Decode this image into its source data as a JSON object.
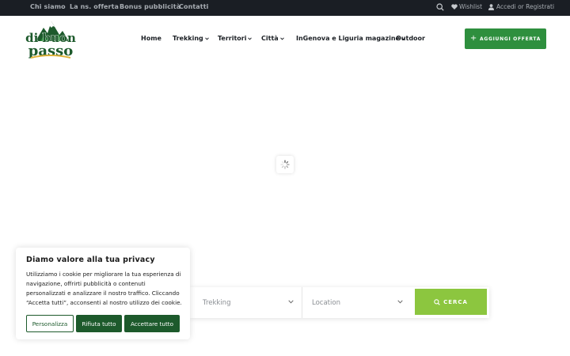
{
  "topbar": {
    "links": [
      "Chi siamo",
      "La ns. offerta",
      "Bonus pubblicità",
      "Contatti"
    ],
    "search_icon": "search-icon",
    "wishlist_label": "Wishlist",
    "account_label": "Accedi or Registrati"
  },
  "logo": {
    "line1": "di buon",
    "line2": "passo"
  },
  "nav": {
    "items": [
      {
        "label": "Home",
        "dropdown": false
      },
      {
        "label": "Trekking",
        "dropdown": true
      },
      {
        "label": "Territori",
        "dropdown": true
      },
      {
        "label": "Città",
        "dropdown": true
      },
      {
        "label": "InGenova e Liguria magazine",
        "dropdown": true
      },
      {
        "label": "Outdoor",
        "dropdown": false
      }
    ]
  },
  "add_button": {
    "label": "AGGIUNGI OFFERTA"
  },
  "search": {
    "category_value": "Trekking",
    "location_placeholder": "Location",
    "submit_label": "CERCA"
  },
  "cookie": {
    "title": "Diamo valore alla tua privacy",
    "text": "Utilizziamo i cookie per migliorare la tua esperienza di navigazione, offrirti pubblicità o contenuti personalizzati e analizzare il nostro traffico. Cliccando “Accetta tutti”, acconsenti al nostro utilizzo dei cookie.",
    "customize_label": "Personalizza",
    "reject_label": "Rifiuta tutto",
    "accept_label": "Accettare tutto"
  },
  "colors": {
    "topbar_bg": "#1a1e24",
    "brand_green": "#2e8f3e",
    "search_green": "#8cc63f",
    "cookie_green": "#1d5a2c"
  }
}
